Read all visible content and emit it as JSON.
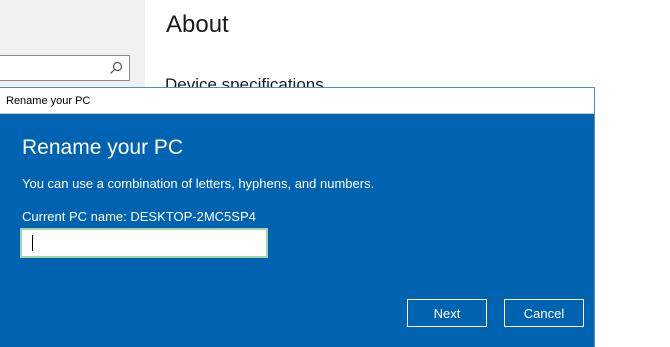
{
  "settings": {
    "title": "About",
    "section": "Device specifications"
  },
  "dialog": {
    "window_title": "Rename your PC",
    "heading": "Rename your PC",
    "description": "You can use a combination of letters, hyphens, and numbers.",
    "current_name_label": "Current PC name: DESKTOP-2MC5SP4",
    "input_value": "",
    "next_label": "Next",
    "cancel_label": "Cancel"
  },
  "colors": {
    "dialog_bg": "#0063b1",
    "input_focus_border": "#9dd7a4"
  },
  "icons": {
    "search": "search-icon"
  }
}
